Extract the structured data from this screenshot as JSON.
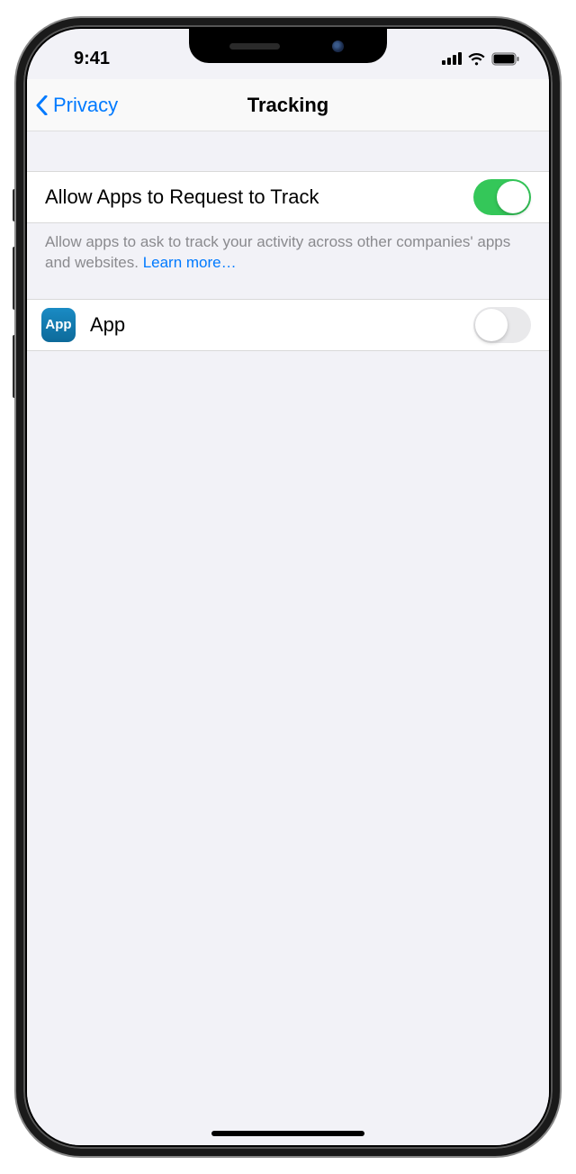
{
  "status": {
    "time": "9:41"
  },
  "nav": {
    "back_label": "Privacy",
    "title": "Tracking"
  },
  "main_toggle": {
    "label": "Allow Apps to Request to Track",
    "on": true
  },
  "footer": {
    "text": "Allow apps to ask to track your activity across other companies' apps and websites. ",
    "link_text": "Learn more…"
  },
  "apps": [
    {
      "icon_label": "App",
      "name": "App",
      "on": false
    }
  ]
}
